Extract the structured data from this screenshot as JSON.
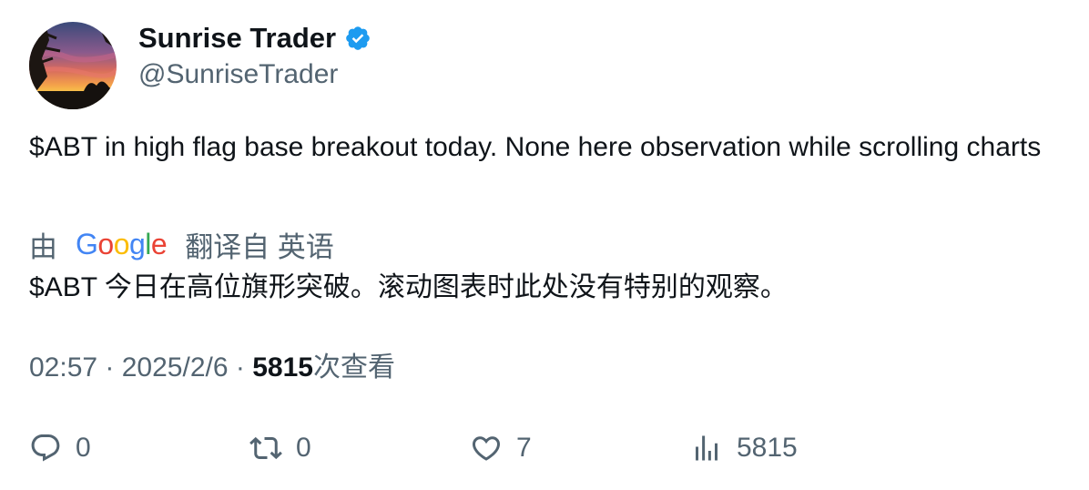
{
  "author": {
    "display_name": "Sunrise Trader",
    "handle": "@SunriseTrader",
    "verified": true,
    "verified_color": "#1d9bf0"
  },
  "tweet": {
    "text": "$ABT in high flag base breakout today.  None here observation while scrolling charts"
  },
  "translation": {
    "prefix": "由",
    "provider": "Google",
    "suffix": "翻译自 英语",
    "text": "$ABT 今日在高位旗形突破。滚动图表时此处没有特别的观察。"
  },
  "meta": {
    "time": "02:57",
    "separator": "·",
    "date": "2025/2/6",
    "views_count": "5815",
    "views_label": "次查看"
  },
  "actions": {
    "replies": "0",
    "retweets": "0",
    "likes": "7",
    "views": "5815"
  },
  "colors": {
    "text_primary": "#0f1419",
    "text_secondary": "#536471",
    "google_blue": "#4285f4",
    "google_red": "#ea4335",
    "google_yellow": "#fbbc05",
    "google_green": "#34a853"
  },
  "icons": {
    "reply": "reply-icon",
    "retweet": "retweet-icon",
    "like": "heart-icon",
    "views": "views-chart-icon",
    "verified": "verified-badge-icon"
  }
}
